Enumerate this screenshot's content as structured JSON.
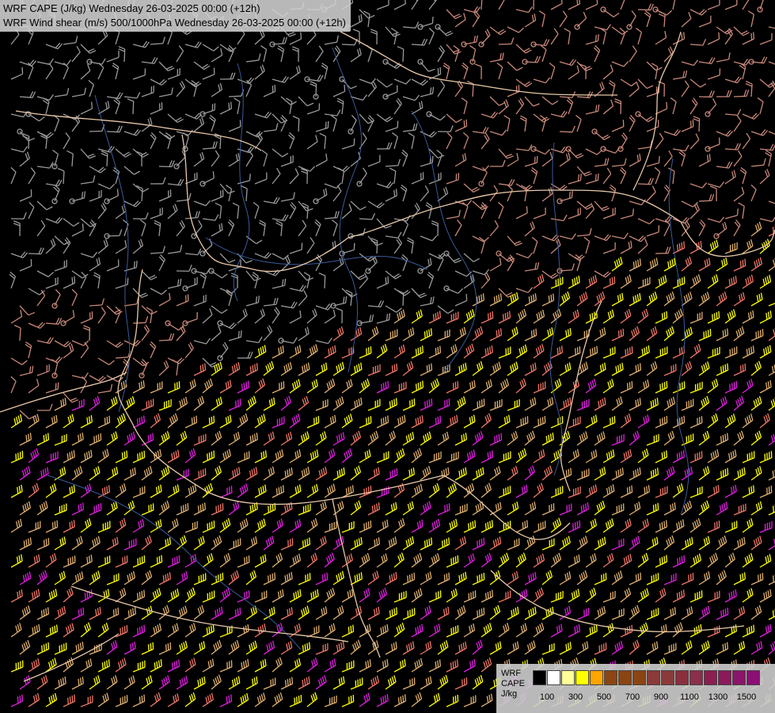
{
  "title": {
    "line1": "WRF CAPE (J/kg) Wednesday 26-03-2025 00:00 (+12h)",
    "line2": "WRF Wind shear (m/s) 500/1000hPa Wednesday 26-03-2025 00:00 (+12h)"
  },
  "legend": {
    "label_model": "WRF",
    "label_var": "CAPE",
    "label_unit": "J/kg",
    "swatch_colors": [
      "#000000",
      "#ffffff",
      "#ffff99",
      "#ffff00",
      "#ffa500",
      "#8b4513",
      "#8b4513",
      "#8b4513",
      "#8b3a3a",
      "#8b3a3a",
      "#8b2f3f",
      "#8b2f4a",
      "#8b1f4f",
      "#8b1a5a",
      "#8b156a",
      "#8b0f75"
    ],
    "ticks": [
      "100",
      "300",
      "500",
      "700",
      "900",
      "1100",
      "1300",
      "1500"
    ]
  },
  "colors": {
    "background": "#000000",
    "borders": "#e8c8a8",
    "rivers": "#3a5a9a",
    "barb_low": "#9a9a9a",
    "barb_mid": "#c8887a",
    "barb_high_yellow": "#ffff00",
    "barb_tan": "#e0b070",
    "barb_magenta": "#e020e0",
    "barb_salmon": "#f07868"
  }
}
